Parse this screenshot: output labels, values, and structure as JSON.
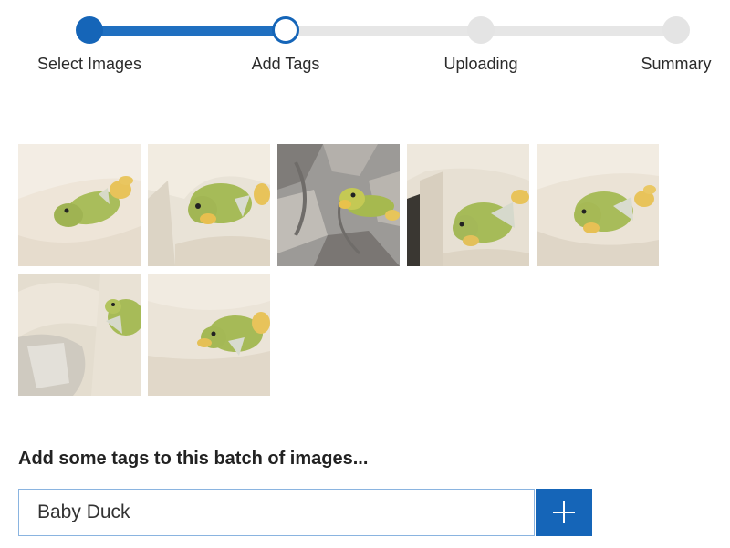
{
  "stepper": {
    "steps": [
      {
        "label": "Select Images",
        "status": "complete"
      },
      {
        "label": "Add Tags",
        "status": "current"
      },
      {
        "label": "Uploading",
        "status": "pending"
      },
      {
        "label": "Summary",
        "status": "pending"
      }
    ],
    "progress_fraction": 0.33
  },
  "gallery": {
    "image_count": 7,
    "images": [
      {
        "name": "duck-photo-1"
      },
      {
        "name": "duck-photo-2"
      },
      {
        "name": "duck-photo-3"
      },
      {
        "name": "duck-photo-4"
      },
      {
        "name": "duck-photo-5"
      },
      {
        "name": "duck-photo-6"
      },
      {
        "name": "duck-photo-7"
      }
    ]
  },
  "tags": {
    "heading": "Add some tags to this batch of images...",
    "input_value": "Baby Duck"
  },
  "icons": {
    "add_button": "plus-icon"
  },
  "colors": {
    "accent": "#1565b8",
    "track": "#e6e6e6",
    "input_border": "#8ab4e0"
  }
}
